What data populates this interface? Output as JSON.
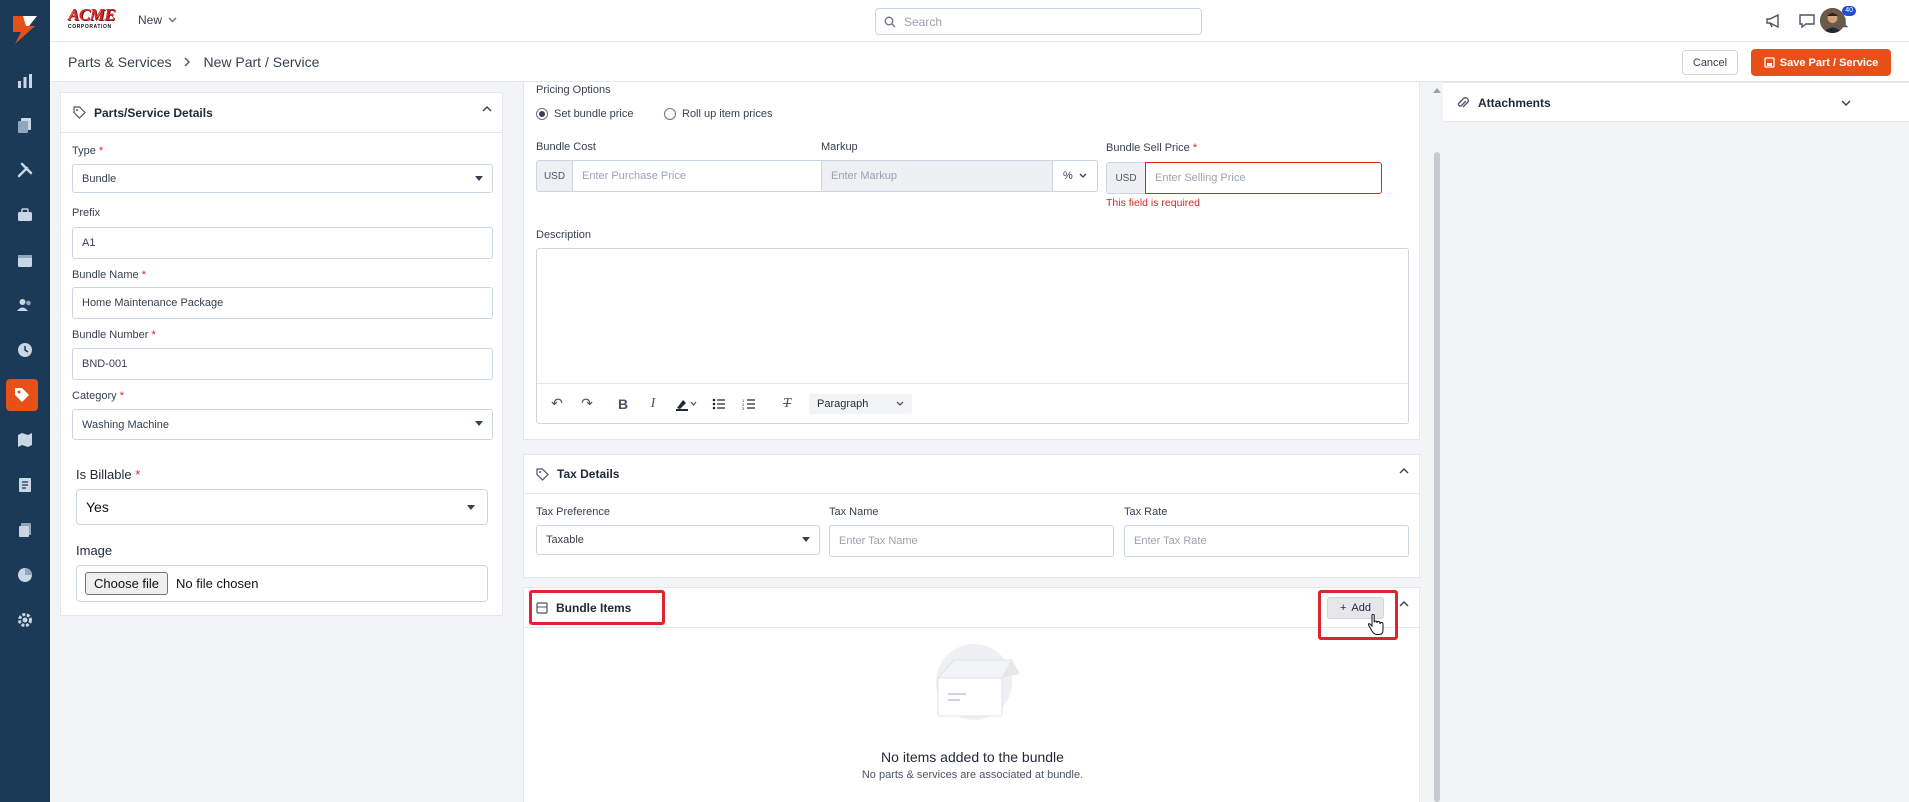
{
  "brand": {
    "name": "ACME",
    "sub": "CORPORATION"
  },
  "topbar": {
    "new_label": "New",
    "search_placeholder": "Search",
    "notification_count": "40"
  },
  "breadcrumb": {
    "parent": "Parts & Services",
    "current": "New Part / Service"
  },
  "actions": {
    "cancel": "Cancel",
    "save": "Save Part / Service"
  },
  "details": {
    "title": "Parts/Service Details",
    "type_label": "Type",
    "type_value": "Bundle",
    "prefix_label": "Prefix",
    "prefix_value": "A1",
    "name_label": "Bundle Name",
    "name_value": "Home Maintenance Package",
    "number_label": "Bundle Number",
    "number_value": "BND-001",
    "category_label": "Category",
    "category_value": "Washing Machine",
    "billable_label": "Is Billable",
    "billable_value": "Yes",
    "image_label": "Image",
    "choose_file": "Choose file",
    "no_file": "No file chosen"
  },
  "pricing": {
    "options_label": "Pricing Options",
    "opt1": "Set bundle price",
    "opt2": "Roll up item prices",
    "cost_label": "Bundle Cost",
    "currency": "USD",
    "cost_placeholder": "Enter Purchase Price",
    "markup_label": "Markup",
    "markup_placeholder": "Enter Markup",
    "markup_unit": "%",
    "sell_label": "Bundle Sell Price",
    "sell_placeholder": "Enter Selling Price",
    "error": "This field is required",
    "description_label": "Description",
    "paragraph": "Paragraph"
  },
  "tax": {
    "title": "Tax Details",
    "pref_label": "Tax Preference",
    "pref_value": "Taxable",
    "name_label": "Tax Name",
    "name_placeholder": "Enter Tax Name",
    "rate_label": "Tax Rate",
    "rate_placeholder": "Enter Tax Rate"
  },
  "bundle": {
    "title": "Bundle Items",
    "add": "Add",
    "empty_title": "No items added to the bundle",
    "empty_sub": "No parts & services are associated at bundle."
  },
  "attachments": {
    "title": "Attachments"
  },
  "colors": {
    "accent": "#e8501a",
    "rail": "#1b3a57",
    "error": "#dc2626",
    "highlight": "#e0242f"
  }
}
